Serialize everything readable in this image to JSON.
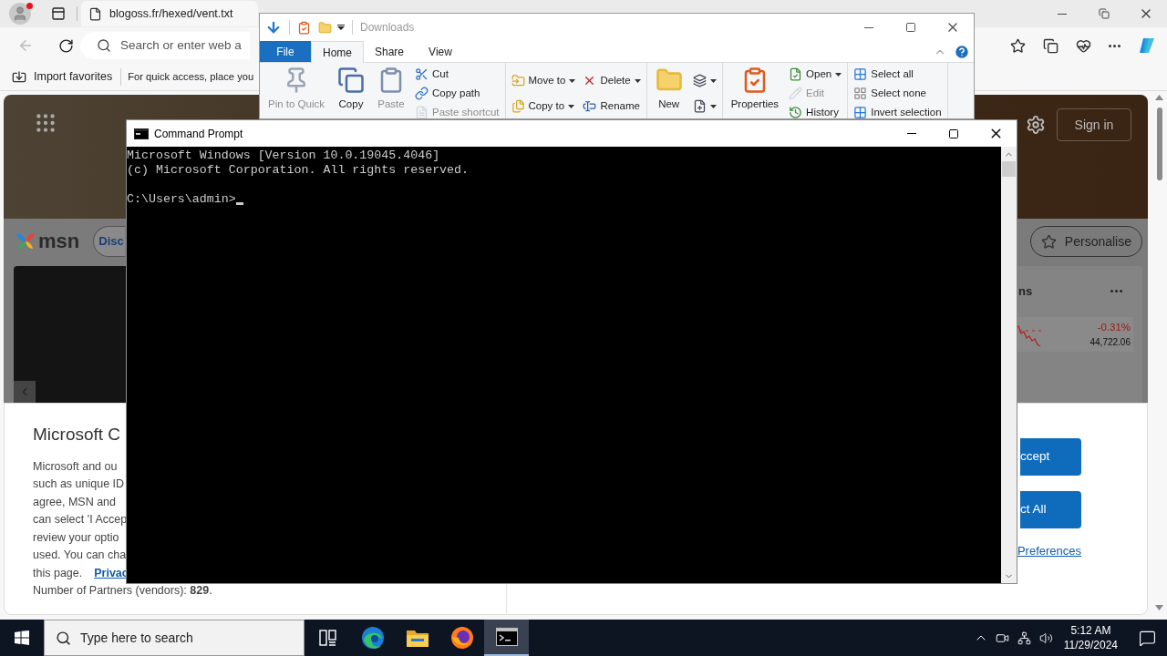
{
  "browser": {
    "tabs": [
      {
        "title": "blogoss.fr/hexed/vent.txt",
        "selected": true
      }
    ],
    "address_bar": {
      "placeholder": "Search or enter web a"
    },
    "favorites_bar": [
      {
        "kind": "import",
        "label": "Import favorites"
      },
      {
        "kind": "hint",
        "label": "For quick access, place you"
      }
    ],
    "page": {
      "header": {
        "sign_in": "Sign in"
      },
      "nav": {
        "logo": "msn",
        "pill": "Disc",
        "personalise": "Personalise"
      },
      "markets_card": {
        "title": "ns",
        "change": "-0.31%",
        "value": "44,722.06"
      },
      "consent": {
        "title": "Microsoft C",
        "lines": [
          "Microsoft and ou",
          "such as unique ID",
          "agree, MSN and",
          "can select 'I Accep",
          "review your optio",
          "used. You can cha"
        ],
        "last_line": "this page.",
        "link": "Privac",
        "partners": "Number of Partners (vendors): **829**.",
        "buttons": [
          "ccept",
          "ct All"
        ],
        "preferences_link": "Preferences"
      }
    }
  },
  "file_explorer": {
    "title": "Downloads",
    "ribbon_tabs": [
      {
        "label": "File",
        "kind": "file",
        "selected": false
      },
      {
        "label": "Home",
        "kind": "tab",
        "selected": true
      },
      {
        "label": "Share",
        "kind": "tab",
        "selected": false
      },
      {
        "label": "View",
        "kind": "tab",
        "selected": false
      }
    ],
    "groups": [
      [
        [
          {
            "label": "Pin to Quick",
            "kind": "large",
            "disabled": true,
            "dropdown": false
          }
        ],
        [
          {
            "label": "Copy",
            "kind": "large",
            "disabled": false,
            "dropdown": false
          }
        ],
        [
          {
            "label": "Paste",
            "kind": "large",
            "disabled": true,
            "dropdown": false
          }
        ],
        [
          {
            "label": "Cut",
            "kind": "small",
            "disabled": false,
            "dropdown": false
          },
          {
            "label": "Copy path",
            "kind": "small",
            "disabled": false,
            "dropdown": false
          },
          {
            "label": "Paste shortcut",
            "kind": "small",
            "disabled": true,
            "dropdown": false
          }
        ]
      ],
      [
        [
          {
            "label": "Move to",
            "kind": "small",
            "disabled": false,
            "dropdown": true
          },
          {
            "label": "Copy to",
            "kind": "small",
            "disabled": false,
            "dropdown": true
          }
        ],
        [
          {
            "label": "Delete",
            "kind": "small",
            "disabled": false,
            "dropdown": true
          },
          {
            "label": "Rename",
            "kind": "small",
            "disabled": false,
            "dropdown": false
          }
        ]
      ],
      [
        [
          {
            "label": "New",
            "kind": "large",
            "disabled": false,
            "dropdown": false
          }
        ],
        [
          {
            "kind": "small",
            "disabled": false,
            "dropdown": true
          },
          {
            "kind": "small",
            "disabled": false,
            "dropdown": true
          }
        ]
      ],
      [
        [
          {
            "label": "Properties",
            "kind": "large",
            "disabled": false,
            "dropdown": false
          }
        ],
        [
          {
            "label": "Open",
            "kind": "small",
            "disabled": false,
            "dropdown": true
          },
          {
            "label": "Edit",
            "kind": "small",
            "disabled": true,
            "dropdown": false
          },
          {
            "label": "History",
            "kind": "small",
            "disabled": false,
            "dropdown": false
          }
        ]
      ],
      [
        [
          {
            "label": "Select all",
            "kind": "small",
            "disabled": false,
            "dropdown": false
          },
          {
            "label": "Select none",
            "kind": "small",
            "disabled": false,
            "dropdown": false
          },
          {
            "label": "Invert selection",
            "kind": "small",
            "disabled": false,
            "dropdown": false
          }
        ]
      ]
    ]
  },
  "command_prompt": {
    "title": "Command Prompt",
    "lines": [
      "Microsoft Windows [Version 10.0.19045.4046]",
      "(c) Microsoft Corporation. All rights reserved."
    ],
    "prompt": "C:\\Users\\admin>"
  },
  "taskbar": {
    "search_placeholder": "Type here to search",
    "apps": [
      {
        "kind": "task-view",
        "active": false
      },
      {
        "kind": "edge",
        "active": false
      },
      {
        "kind": "explorer",
        "active": false
      },
      {
        "kind": "firefox",
        "active": false
      },
      {
        "kind": "cmd",
        "active": true
      }
    ],
    "clock": {
      "time": "5:12 AM",
      "date": "11/29/2024"
    }
  }
}
